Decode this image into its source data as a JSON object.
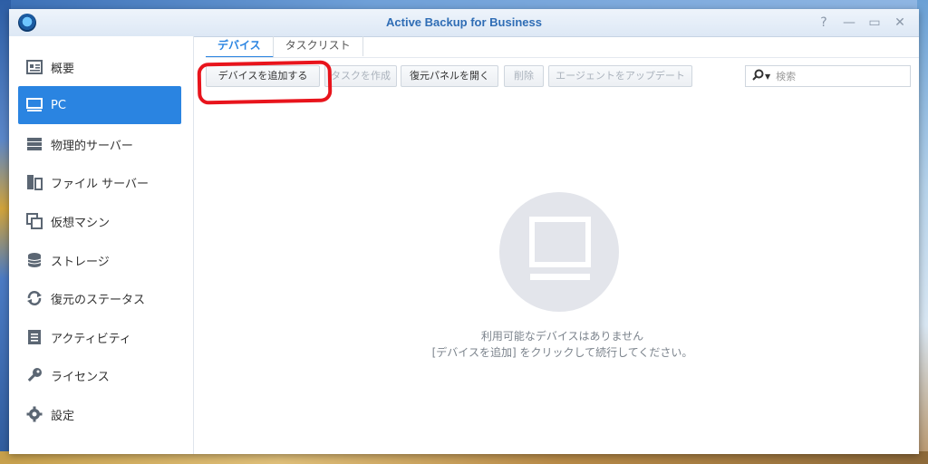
{
  "window": {
    "title": "Active Backup for Business",
    "controls": [
      "?",
      "—",
      "▭",
      "✕"
    ]
  },
  "sidebar": {
    "items": [
      {
        "label": "概要",
        "icon": "overview-icon",
        "active": false
      },
      {
        "label": "PC",
        "icon": "pc-monitor-icon",
        "active": true
      },
      {
        "label": "物理的サーバー",
        "icon": "server-icon",
        "active": false
      },
      {
        "label": "ファイル サーバー",
        "icon": "file-server-icon",
        "active": false
      },
      {
        "label": "仮想マシン",
        "icon": "virtual-machine-icon",
        "active": false
      },
      {
        "label": "ストレージ",
        "icon": "storage-icon",
        "active": false
      },
      {
        "label": "復元のステータス",
        "icon": "restore-status-icon",
        "active": false
      },
      {
        "label": "アクティビティ",
        "icon": "activity-icon",
        "active": false
      },
      {
        "label": "ライセンス",
        "icon": "key-icon",
        "active": false
      },
      {
        "label": "設定",
        "icon": "gear-icon",
        "active": false
      }
    ]
  },
  "tabs": [
    {
      "label": "デバイス",
      "active": true
    },
    {
      "label": "タスクリスト",
      "active": false
    }
  ],
  "toolbar": {
    "add_device": "デバイスを追加する",
    "create_task": "タスクを作成",
    "open_restore_panel": "復元パネルを開く",
    "delete": "削除",
    "update_agent": "エージェントをアップデート"
  },
  "search": {
    "placeholder": "検索"
  },
  "empty_state": {
    "line1": "利用可能なデバイスはありません",
    "line2": "[デバイスを追加] をクリックして続行してください。"
  },
  "colors": {
    "accent": "#2a84e1",
    "highlight": "#e8141c"
  }
}
